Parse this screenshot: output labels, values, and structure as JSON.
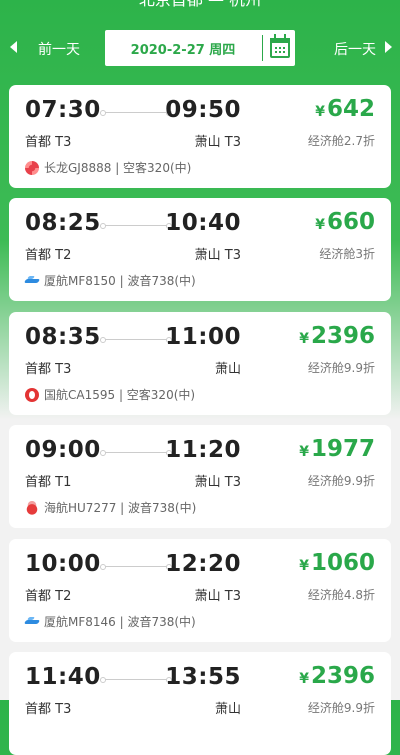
{
  "header": {
    "back_glyph": "‹",
    "title": "北京首都 — 杭州",
    "more_glyph": "◦◦"
  },
  "datebar": {
    "prev_label": "前一天",
    "date_text": "2020-2-27 周四",
    "next_label": "后一天",
    "calendar_icon": "calendar-icon",
    "accent": "#2ca84a"
  },
  "flights": [
    {
      "dep_time": "07:30",
      "arr_time": "09:50",
      "dep_airport": "首都 T3",
      "arr_airport": "萧山 T3",
      "price": "642",
      "cabin": "经济舱2.7折",
      "airline": "长龙GJ8888 | 空客320(中)",
      "logo": "longhao"
    },
    {
      "dep_time": "08:25",
      "arr_time": "10:40",
      "dep_airport": "首都 T2",
      "arr_airport": "萧山 T3",
      "price": "660",
      "cabin": "经济舱3折",
      "airline": "厦航MF8150 | 波音738(中)",
      "logo": "xiamen"
    },
    {
      "dep_time": "08:35",
      "arr_time": "11:00",
      "dep_airport": "首都 T3",
      "arr_airport": "萧山",
      "price": "2396",
      "cabin": "经济舱9.9折",
      "airline": "国航CA1595 | 空客320(中)",
      "logo": "airchina"
    },
    {
      "dep_time": "09:00",
      "arr_time": "11:20",
      "dep_airport": "首都 T1",
      "arr_airport": "萧山 T3",
      "price": "1977",
      "cabin": "经济舱9.9折",
      "airline": "海航HU7277 | 波音738(中)",
      "logo": "hainan"
    },
    {
      "dep_time": "10:00",
      "arr_time": "12:20",
      "dep_airport": "首都 T2",
      "arr_airport": "萧山 T3",
      "price": "1060",
      "cabin": "经济舱4.8折",
      "airline": "厦航MF8146 | 波音738(中)",
      "logo": "xiamen"
    },
    {
      "dep_time": "11:40",
      "arr_time": "13:55",
      "dep_airport": "首都 T3",
      "arr_airport": "萧山",
      "price": "2396",
      "cabin": "经济舱9.9折",
      "airline": "",
      "logo": ""
    }
  ],
  "currency_symbol": "¥"
}
